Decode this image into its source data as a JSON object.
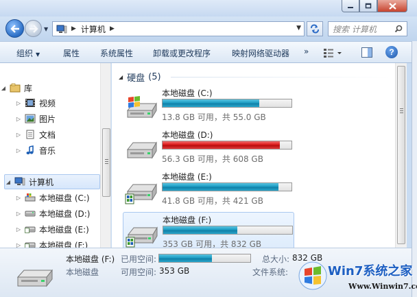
{
  "window": {
    "caption_buttons": {
      "minimize": "minimize",
      "maximize": "maximize",
      "close": "close"
    }
  },
  "navbar": {
    "address": {
      "location": "计算机"
    },
    "search": {
      "placeholder": "搜索 计算机"
    }
  },
  "toolbar": {
    "items": [
      {
        "label": "组织",
        "has_dropdown": true
      },
      {
        "label": "属性"
      },
      {
        "label": "系统属性"
      },
      {
        "label": "卸载或更改程序"
      },
      {
        "label": "映射网络驱动器"
      }
    ],
    "more": "»",
    "help": "?"
  },
  "sidebar": {
    "items": [
      {
        "label": "库",
        "icon": "library-icon",
        "expanded": true
      },
      {
        "label": "视频",
        "icon": "video-library-icon"
      },
      {
        "label": "图片",
        "icon": "pictures-library-icon"
      },
      {
        "label": "文档",
        "icon": "documents-library-icon"
      },
      {
        "label": "音乐",
        "icon": "music-library-icon"
      },
      {
        "label": "计算机",
        "icon": "computer-icon",
        "expanded": true,
        "selected": true
      },
      {
        "label": "本地磁盘 (C:)",
        "icon": "system-drive-icon"
      },
      {
        "label": "本地磁盘 (D:)",
        "icon": "hard-drive-icon"
      },
      {
        "label": "本地磁盘 (E:)",
        "icon": "hard-drive-icon"
      },
      {
        "label": "本地磁盘 (F:)",
        "icon": "hard-drive-icon"
      }
    ]
  },
  "main": {
    "group": {
      "title": "硬盘",
      "count": "(5)"
    },
    "drives": [
      {
        "name": "本地磁盘 (C:)",
        "info": "13.8 GB 可用，共 55.0 GB",
        "used_fraction": 0.749,
        "full": false,
        "icon": "windows-drive-icon"
      },
      {
        "name": "本地磁盘 (D:)",
        "info": "56.3 GB 可用，共 608 GB",
        "used_fraction": 0.907,
        "full": true,
        "icon": "hard-drive-icon"
      },
      {
        "name": "本地磁盘 (E:)",
        "info": "41.8 GB 可用，共 421 GB",
        "used_fraction": 0.901,
        "full": false,
        "icon": "hard-drive-icon"
      },
      {
        "name": "本地磁盘 (F:)",
        "info": "353 GB 可用，共 832 GB",
        "used_fraction": 0.576,
        "full": false,
        "icon": "hard-drive-icon",
        "selected": true
      }
    ]
  },
  "details": {
    "name": "本地磁盘 (F:)",
    "type": "本地磁盘",
    "used_label": "已用空间:",
    "free_label": "可用空间:",
    "free_value": "353 GB",
    "total_label": "总大小:",
    "total_value": "832 GB",
    "fs_label": "文件系统:",
    "used_fraction": 0.576
  },
  "watermark": {
    "title": "Win7系统之家",
    "url": "Www.Winwin7.com"
  },
  "colors": {
    "bar_normal": "#1c9dc4",
    "bar_full": "#dc1b1b",
    "window_frame": "#c9dcf2",
    "selection": "#d6e6fb"
  }
}
